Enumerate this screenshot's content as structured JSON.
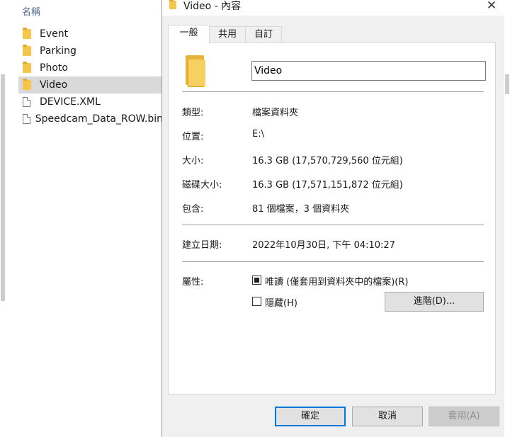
{
  "explorer": {
    "column_header": "名稱",
    "items": [
      {
        "label": "Event",
        "type": "folder"
      },
      {
        "label": "Parking",
        "type": "folder"
      },
      {
        "label": "Photo",
        "type": "folder"
      },
      {
        "label": "Video",
        "type": "folder",
        "selected": true
      },
      {
        "label": "DEVICE.XML",
        "type": "file"
      },
      {
        "label": "Speedcam_Data_ROW.bin",
        "type": "file"
      }
    ]
  },
  "dialog": {
    "title": "Video - 內容",
    "close_glyph": "✕",
    "tabs": [
      {
        "label": "一般",
        "active": true
      },
      {
        "label": "共用",
        "active": false
      },
      {
        "label": "自訂",
        "active": false
      }
    ],
    "name_value": "Video",
    "properties": {
      "type_label": "類型:",
      "type_value": "檔案資料夾",
      "location_label": "位置:",
      "location_value": "E:\\",
      "size_label": "大小:",
      "size_value": "16.3 GB (17,570,729,560 位元組)",
      "disk_size_label": "磁碟大小:",
      "disk_size_value": "16.3 GB (17,571,151,872 位元組)",
      "contains_label": "包含:",
      "contains_value": "81 個檔案，3 個資料夾",
      "created_label": "建立日期:",
      "created_value": "2022年10月30日, 下午 04:10:27",
      "attributes_label": "屬性:"
    },
    "attributes": {
      "readonly_label": "唯讀 (僅套用到資料夾中的檔案)(R)",
      "readonly_state": "indeterminate",
      "hidden_label": "隱藏(H)",
      "hidden_state": "unchecked",
      "advanced_button": "進階(D)..."
    },
    "buttons": {
      "ok": "確定",
      "cancel": "取消",
      "apply": "套用(A)"
    }
  },
  "colors": {
    "accent": "#0078d7",
    "folder": "#f4c64b",
    "selection": "#d9d9d9",
    "dialog_bg": "#f0f0f0"
  }
}
